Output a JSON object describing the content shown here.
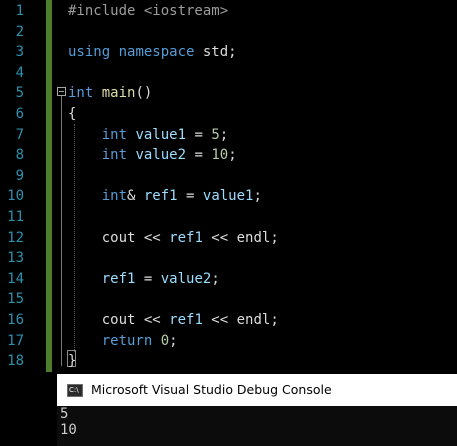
{
  "editor": {
    "line_numbers": [
      "1",
      "2",
      "3",
      "4",
      "5",
      "6",
      "7",
      "8",
      "9",
      "10",
      "11",
      "12",
      "13",
      "14",
      "15",
      "16",
      "17",
      "18"
    ],
    "lines": [
      [
        {
          "t": "#include <iostream>",
          "c": "pp"
        }
      ],
      [],
      [
        {
          "t": "using",
          "c": "kw"
        },
        {
          "t": " ",
          "c": "plain"
        },
        {
          "t": "namespace",
          "c": "kw"
        },
        {
          "t": " std;",
          "c": "plain"
        }
      ],
      [],
      [
        {
          "t": "int",
          "c": "kw"
        },
        {
          "t": " ",
          "c": "plain"
        },
        {
          "t": "main",
          "c": "fn"
        },
        {
          "t": "()",
          "c": "punc"
        }
      ],
      [
        {
          "t": "{",
          "c": "punc"
        }
      ],
      [
        {
          "t": "    ",
          "c": "plain"
        },
        {
          "t": "int",
          "c": "kw"
        },
        {
          "t": " ",
          "c": "plain"
        },
        {
          "t": "value1",
          "c": "var"
        },
        {
          "t": " = ",
          "c": "plain"
        },
        {
          "t": "5",
          "c": "num"
        },
        {
          "t": ";",
          "c": "punc"
        }
      ],
      [
        {
          "t": "    ",
          "c": "plain"
        },
        {
          "t": "int",
          "c": "kw"
        },
        {
          "t": " ",
          "c": "plain"
        },
        {
          "t": "value2",
          "c": "var"
        },
        {
          "t": " = ",
          "c": "plain"
        },
        {
          "t": "10",
          "c": "num"
        },
        {
          "t": ";",
          "c": "punc"
        }
      ],
      [],
      [
        {
          "t": "    ",
          "c": "plain"
        },
        {
          "t": "int",
          "c": "kw"
        },
        {
          "t": "& ",
          "c": "plain"
        },
        {
          "t": "ref1",
          "c": "var"
        },
        {
          "t": " = ",
          "c": "plain"
        },
        {
          "t": "value1",
          "c": "var"
        },
        {
          "t": ";",
          "c": "punc"
        }
      ],
      [],
      [
        {
          "t": "    ",
          "c": "plain"
        },
        {
          "t": "cout",
          "c": "plain"
        },
        {
          "t": " << ",
          "c": "plain"
        },
        {
          "t": "ref1",
          "c": "var"
        },
        {
          "t": " << ",
          "c": "plain"
        },
        {
          "t": "endl",
          "c": "plain"
        },
        {
          "t": ";",
          "c": "punc"
        }
      ],
      [],
      [
        {
          "t": "    ",
          "c": "plain"
        },
        {
          "t": "ref1",
          "c": "var"
        },
        {
          "t": " = ",
          "c": "plain"
        },
        {
          "t": "value2",
          "c": "var"
        },
        {
          "t": ";",
          "c": "punc"
        }
      ],
      [],
      [
        {
          "t": "    ",
          "c": "plain"
        },
        {
          "t": "cout",
          "c": "plain"
        },
        {
          "t": " << ",
          "c": "plain"
        },
        {
          "t": "ref1",
          "c": "var"
        },
        {
          "t": " << ",
          "c": "plain"
        },
        {
          "t": "endl",
          "c": "plain"
        },
        {
          "t": ";",
          "c": "punc"
        }
      ],
      [
        {
          "t": "    ",
          "c": "plain"
        },
        {
          "t": "return",
          "c": "kw"
        },
        {
          "t": " ",
          "c": "plain"
        },
        {
          "t": "0",
          "c": "num"
        },
        {
          "t": ";",
          "c": "punc"
        }
      ],
      [
        {
          "t": "}",
          "c": "punc"
        }
      ]
    ],
    "colors": {
      "line_number": "#2b91af",
      "keyword": "#569cd6",
      "preprocessor": "#9b9b9b",
      "function": "#dcdcaa",
      "variable": "#9cdcfe",
      "number": "#b5cea8",
      "change_bar": "#4e7d2b"
    }
  },
  "console": {
    "title": "Microsoft Visual Studio Debug Console",
    "icon": "console-window-icon",
    "output_lines": [
      "5",
      "10"
    ]
  }
}
